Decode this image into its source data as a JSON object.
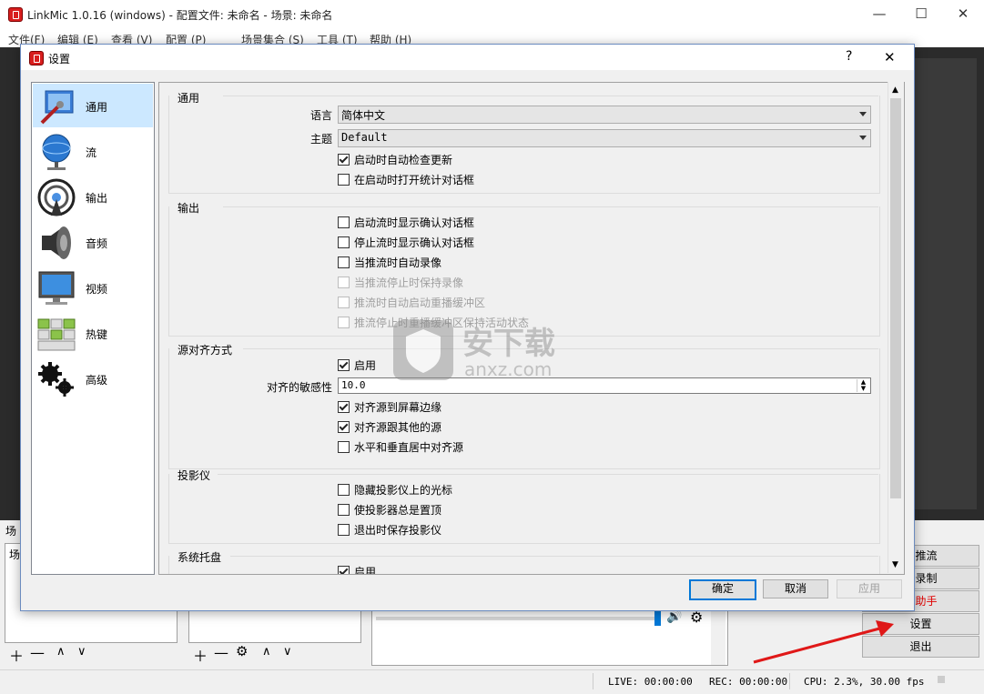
{
  "window": {
    "title": "LinkMic 1.0.16 (windows) - 配置文件: 未命名 - 场景: 未命名",
    "minimize": "—",
    "maximize": "☐",
    "close": "✕"
  },
  "menu": [
    "文件(F)",
    "编辑 (E)",
    "查看 (V)",
    "配置 (P)",
    "场景集合 (S)",
    "工具 (T)",
    "帮助 (H)"
  ],
  "docks": {
    "scenes_header": "场",
    "scenes_item": "场",
    "volume_icon": "🔊",
    "gear_icon": "⚙"
  },
  "controls": {
    "start_stream": "始推流",
    "start_record": "始录制",
    "assistant": "制助手",
    "assistant_color": "#e00000",
    "settings": "设置",
    "exit": "退出"
  },
  "status": {
    "live": "LIVE: 00:00:00",
    "rec": "REC: 00:00:00",
    "cpu": "CPU: 2.3%, 30.00 fps"
  },
  "dialog": {
    "title": "设置",
    "help": "?",
    "close": "✕",
    "nav": [
      {
        "label": "通用",
        "icon": "general-icon"
      },
      {
        "label": "流",
        "icon": "stream-icon"
      },
      {
        "label": "输出",
        "icon": "output-icon"
      },
      {
        "label": "音频",
        "icon": "audio-icon"
      },
      {
        "label": "视频",
        "icon": "video-icon"
      },
      {
        "label": "热键",
        "icon": "hotkeys-icon"
      },
      {
        "label": "高级",
        "icon": "advanced-icon"
      }
    ],
    "general": {
      "title": "通用",
      "language_label": "语言",
      "language_value": "简体中文",
      "theme_label": "主题",
      "theme_value": "Default",
      "check_updates": "启动时自动检查更新",
      "open_stats": "在启动时打开统计对话框"
    },
    "output": {
      "title": "输出",
      "confirm_start": "启动流时显示确认对话框",
      "confirm_stop": "停止流时显示确认对话框",
      "auto_record": "当推流时自动录像",
      "keep_record": "当推流停止时保持录像",
      "auto_replay": "推流时自动启动重播缓冲区",
      "keep_replay": "推流停止时重播缓冲区保持活动状态"
    },
    "snapping": {
      "title": "源对齐方式",
      "enable": "启用",
      "sensitivity_label": "对齐的敏感性",
      "sensitivity_value": "10.0",
      "snap_screen": "对齐源到屏幕边缘",
      "snap_other": "对齐源跟其他的源",
      "snap_center": "水平和垂直居中对齐源"
    },
    "projector": {
      "title": "投影仪",
      "hide_cursor": "隐藏投影仪上的光标",
      "always_top": "使投影器总是置顶",
      "save_exit": "退出时保存投影仪"
    },
    "tray": {
      "title": "系统托盘",
      "enable": "启用"
    },
    "buttons": {
      "ok": "确定",
      "cancel": "取消",
      "apply": "应用"
    }
  },
  "watermark": {
    "brand": "安下载",
    "site": "anxz.com"
  }
}
